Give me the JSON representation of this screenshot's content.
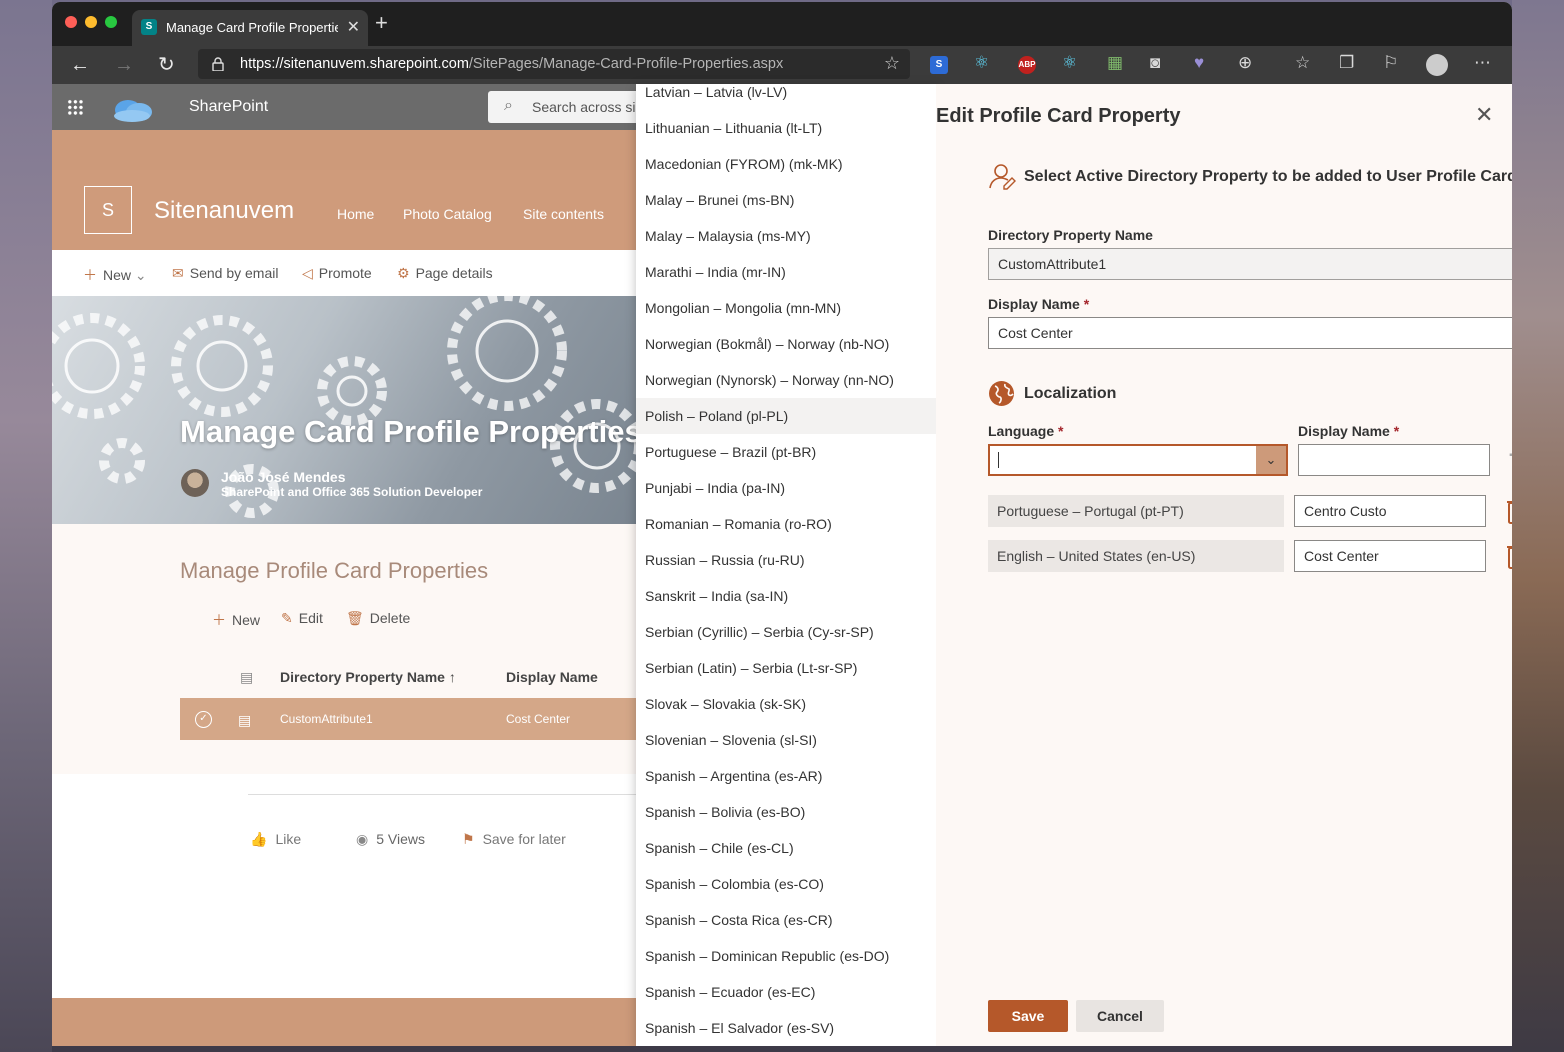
{
  "browser": {
    "tab_title": "Manage Card Profile Properties",
    "url_host": "https://sitenanuvem.sharepoint.com",
    "url_path": "/SitePages/Manage-Card-Profile-Properties.aspx",
    "extensions": [
      "S",
      "ABP"
    ]
  },
  "suite": {
    "app_name": "SharePoint",
    "search_placeholder": "Search across si"
  },
  "site": {
    "logo_letter": "S",
    "title": "Sitenanuvem",
    "nav": [
      "Home",
      "Photo Catalog",
      "Site contents"
    ]
  },
  "commands": {
    "new": "New",
    "send_email": "Send by email",
    "promote": "Promote",
    "page_details": "Page details"
  },
  "hero": {
    "title": "Manage Card Profile Properties",
    "author_name": "João José Mendes",
    "author_role": "SharePoint and Office 365 Solution Developer"
  },
  "list": {
    "title": "Manage Profile Card Properties",
    "cmd_new": "New",
    "cmd_edit": "Edit",
    "cmd_delete": "Delete",
    "col_name": "Directory Property Name ↑",
    "col_display": "Display Name",
    "rows": [
      {
        "name": "CustomAttribute1",
        "display": "Cost Center"
      }
    ]
  },
  "social": {
    "like": "Like",
    "views": "5 Views",
    "save_later": "Save for later"
  },
  "dropdown": {
    "hover_index": 9,
    "items": [
      "Latvian – Latvia (lv-LV)",
      "Lithuanian – Lithuania (lt-LT)",
      "Macedonian (FYROM) (mk-MK)",
      "Malay – Brunei (ms-BN)",
      "Malay – Malaysia (ms-MY)",
      "Marathi – India (mr-IN)",
      "Mongolian – Mongolia (mn-MN)",
      "Norwegian (Bokmål) – Norway (nb-NO)",
      "Norwegian (Nynorsk) – Norway (nn-NO)",
      "Polish – Poland (pl-PL)",
      "Portuguese – Brazil (pt-BR)",
      "Punjabi – India (pa-IN)",
      "Romanian – Romania (ro-RO)",
      "Russian – Russia (ru-RU)",
      "Sanskrit – India (sa-IN)",
      "Serbian (Cyrillic) – Serbia (Cy-sr-SP)",
      "Serbian (Latin) – Serbia (Lt-sr-SP)",
      "Slovak – Slovakia (sk-SK)",
      "Slovenian – Slovenia (sl-SI)",
      "Spanish – Argentina (es-AR)",
      "Spanish – Bolivia (es-BO)",
      "Spanish – Chile (es-CL)",
      "Spanish – Colombia (es-CO)",
      "Spanish – Costa Rica (es-CR)",
      "Spanish – Dominican Republic (es-DO)",
      "Spanish – Ecuador (es-EC)",
      "Spanish – El Salvador (es-SV)"
    ]
  },
  "panel": {
    "title": "Edit Profile Card Property",
    "select_heading": "Select Active Directory Property to be added to User Profile Card",
    "dir_prop_label": "Directory Property Name",
    "dir_prop_value": "CustomAttribute1",
    "display_name_label": "Display Name",
    "display_name_value": "Cost Center",
    "required_mark": "*",
    "localization_heading": "Localization",
    "language_label": "Language",
    "loc_display_label": "Display Name",
    "language_value": "",
    "loc_display_value": "",
    "localizations": [
      {
        "language": "Portuguese – Portugal (pt-PT)",
        "display": "Centro Custo"
      },
      {
        "language": "English – United States (en-US)",
        "display": "Cost Center"
      }
    ],
    "save": "Save",
    "cancel": "Cancel"
  },
  "colors": {
    "theme": "#cd9a7a",
    "accent": "#b5582a",
    "selected_row": "#d4a788"
  }
}
